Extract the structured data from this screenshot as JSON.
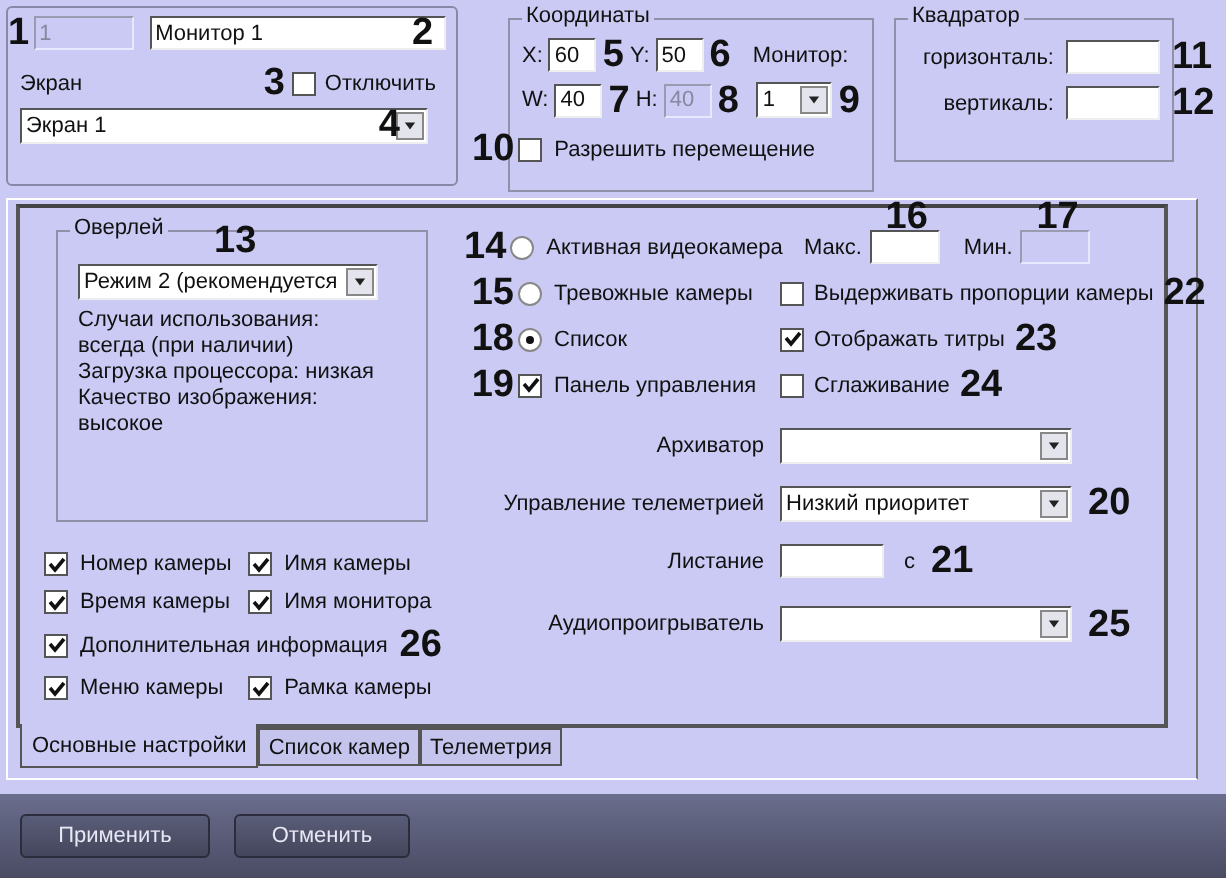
{
  "monitor": {
    "id_marker": "1",
    "id": "1",
    "name": "Монитор 1",
    "name_marker": "2",
    "screen_label": "Экран",
    "disable": {
      "marker": "3",
      "label": "Отключить",
      "checked": false
    },
    "screen": {
      "value": "Экран 1",
      "marker": "4"
    }
  },
  "coordinates": {
    "title": "Координаты",
    "fields": [
      {
        "label": "X:",
        "value": "60",
        "marker": "5",
        "disabled": false
      },
      {
        "label": "Y:",
        "value": "50",
        "marker": "6",
        "disabled": false
      },
      {
        "label": "W:",
        "value": "40",
        "marker": "7",
        "disabled": false
      },
      {
        "label": "H:",
        "value": "40",
        "marker": "8",
        "disabled": true
      }
    ],
    "monitor_label": "Монитор:",
    "monitor": {
      "value": "1",
      "marker": "9"
    },
    "allow_move": {
      "marker": "10",
      "label": "Разрешить перемещение",
      "checked": false
    }
  },
  "quad": {
    "title": "Квадратор",
    "fields": [
      {
        "label": "горизонталь:",
        "marker": "11"
      },
      {
        "label": "вертикаль:",
        "marker": "12"
      }
    ]
  },
  "overlay": {
    "title": "Оверлей",
    "marker": "13",
    "mode": "Режим 2 (рекомендуется",
    "description": [
      "Случаи использования:",
      "всегда (при наличии)",
      "Загрузка процессора: низкая",
      "Качество изображения:",
      "высокое"
    ]
  },
  "display_options": [
    [
      {
        "label": "Номер камеры",
        "checked": true
      },
      {
        "label": "Имя камеры",
        "checked": true
      }
    ],
    [
      {
        "label": "Время камеры",
        "checked": true
      },
      {
        "label": "Имя монитора",
        "checked": true
      }
    ],
    [
      {
        "label": "Дополнительная информация",
        "checked": true,
        "marker": "26"
      }
    ],
    [
      {
        "label": "Меню камеры",
        "checked": true
      },
      {
        "label": "Рамка камеры",
        "checked": true
      }
    ]
  ],
  "sources": [
    {
      "kind": "radio",
      "marker": "14",
      "label": "Активная видеокамера",
      "selected": false
    },
    {
      "kind": "radio",
      "marker": "15",
      "label": "Тревожные камеры",
      "selected": false
    },
    {
      "kind": "radio",
      "marker": "18",
      "label": "Список",
      "selected": true
    },
    {
      "kind": "checkbox",
      "marker": "19",
      "label": "Панель управления",
      "checked": true
    }
  ],
  "range": [
    {
      "label": "Макс.",
      "marker": "16",
      "disabled": false
    },
    {
      "label": "Мин.",
      "marker": "17",
      "disabled": true
    }
  ],
  "options": [
    {
      "label": "Выдерживать пропорции камеры",
      "checked": false,
      "marker": "22"
    },
    {
      "label": "Отображать титры",
      "checked": true,
      "marker": "23"
    },
    {
      "label": "Сглаживание",
      "checked": false,
      "marker": "24"
    }
  ],
  "form": [
    {
      "kind": "select",
      "label": "Архиватор"
    },
    {
      "kind": "select",
      "label": "Управление телеметрией",
      "value": "Низкий приоритет",
      "marker": "20"
    },
    {
      "kind": "field",
      "label": "Листание",
      "unit": "с",
      "marker": "21"
    },
    {
      "kind": "select",
      "label": "Аудиопроигрыватель",
      "marker": "25"
    }
  ],
  "tabs": [
    {
      "label": "Основные настройки",
      "selected": true
    },
    {
      "label": "Список камер",
      "selected": false
    },
    {
      "label": "Телеметрия",
      "selected": false
    }
  ],
  "buttons": [
    "Применить",
    "Отменить"
  ]
}
